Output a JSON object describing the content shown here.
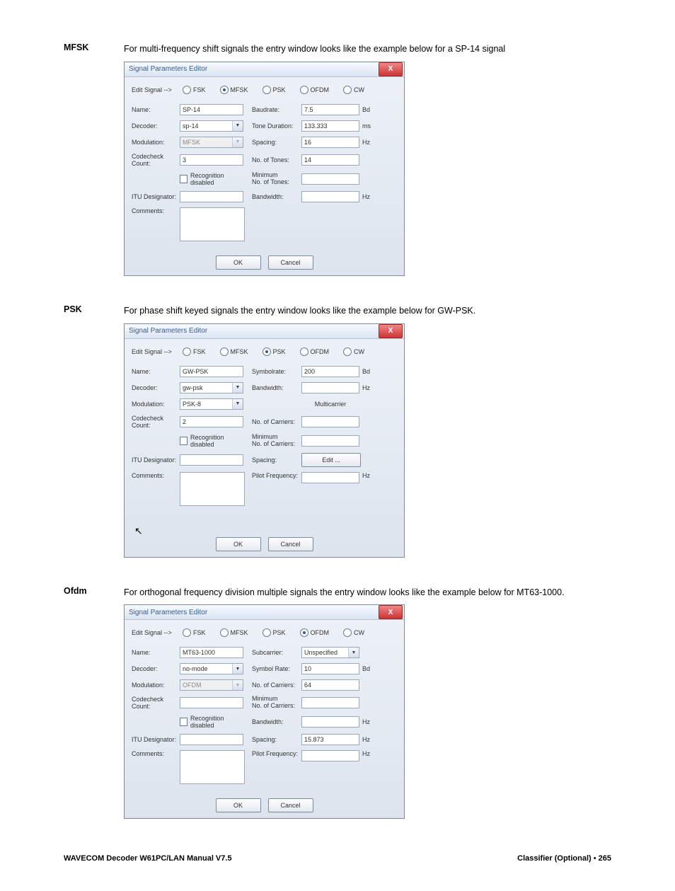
{
  "sections": {
    "mfsk": {
      "label": "MFSK",
      "text": "For multi-frequency shift signals the entry window looks like the example below for a SP-14 signal"
    },
    "psk": {
      "label": "PSK",
      "text": "For phase shift keyed signals the entry window looks like the example below for GW-PSK."
    },
    "ofdm": {
      "label": "Ofdm",
      "text": "For orthogonal frequency division multiple signals the entry window looks like the example below for MT63-1000."
    }
  },
  "dialog": {
    "title": "Signal Parameters Editor",
    "close": "X",
    "edit_signal": "Edit Signal -->",
    "radios": {
      "fsk": "FSK",
      "mfsk": "MFSK",
      "psk": "PSK",
      "ofdm": "OFDM",
      "cw": "CW"
    },
    "labels": {
      "name": "Name:",
      "decoder": "Decoder:",
      "modulation": "Modulation:",
      "codecheck": "Codecheck Count:",
      "itu": "ITU Designator:",
      "comments": "Comments:",
      "baudrate": "Baudrate:",
      "tone_duration": "Tone Duration:",
      "spacing": "Spacing:",
      "no_tones": "No. of Tones:",
      "min_tones": "Minimum\nNo. of Tones:",
      "bandwidth": "Bandwidth:",
      "symbolrate": "Symbolrate:",
      "multicarrier": "Multicarrier",
      "no_carriers": "No. of Carriers:",
      "min_carriers": "Minimum\nNo. of Carriers:",
      "pilot": "Pilot Frequency:",
      "subcarrier": "Subcarrier:",
      "symbol_rate": "Symbol Rate:",
      "recognition": "Recognition disabled",
      "edit_btn": "Edit ...",
      "ok": "OK",
      "cancel": "Cancel"
    },
    "units": {
      "bd": "Bd",
      "ms": "ms",
      "hz": "Hz"
    }
  },
  "mfsk_form": {
    "name": "SP-14",
    "decoder": "sp-14",
    "modulation": "MFSK",
    "codecheck": "3",
    "baudrate": "7.5",
    "tone_duration": "133.333",
    "spacing": "16",
    "no_tones": "14"
  },
  "psk_form": {
    "name": "GW-PSK",
    "decoder": "gw-psk",
    "modulation": "PSK-8",
    "codecheck": "2",
    "symbolrate": "200"
  },
  "ofdm_form": {
    "name": "MT63-1000",
    "decoder": "no-mode",
    "modulation": "OFDM",
    "subcarrier": "Unspecified",
    "symbol_rate": "10",
    "no_carriers": "64",
    "spacing": "15.873"
  },
  "footer": {
    "left": "WAVECOM Decoder W61PC/LAN Manual V7.5",
    "right_bold": "Classifier (Optional)",
    "right_sep": "  •  ",
    "right_page": "265"
  }
}
